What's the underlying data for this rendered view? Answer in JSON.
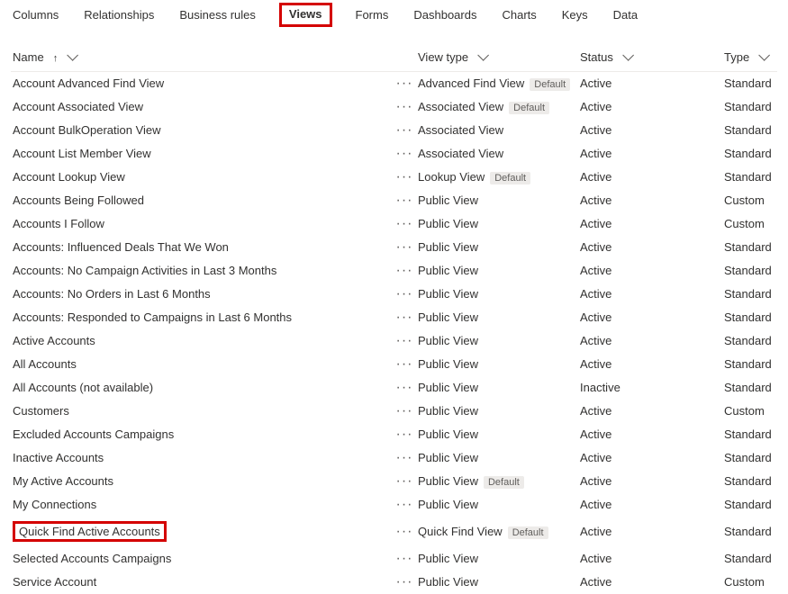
{
  "tabs": {
    "items": [
      {
        "label": "Columns",
        "key": "columns"
      },
      {
        "label": "Relationships",
        "key": "relationships"
      },
      {
        "label": "Business rules",
        "key": "business-rules"
      },
      {
        "label": "Views",
        "key": "views",
        "active": true,
        "highlight": true
      },
      {
        "label": "Forms",
        "key": "forms"
      },
      {
        "label": "Dashboards",
        "key": "dashboards"
      },
      {
        "label": "Charts",
        "key": "charts"
      },
      {
        "label": "Keys",
        "key": "keys"
      },
      {
        "label": "Data",
        "key": "data"
      }
    ]
  },
  "columns": {
    "name": "Name",
    "view_type": "View type",
    "status": "Status",
    "type": "Type"
  },
  "badge_default": "Default",
  "more_glyph": "···",
  "rows": [
    {
      "name": "Account Advanced Find View",
      "view_type": "Advanced Find View",
      "default": true,
      "status": "Active",
      "type": "Standard"
    },
    {
      "name": "Account Associated View",
      "view_type": "Associated View",
      "default": true,
      "status": "Active",
      "type": "Standard"
    },
    {
      "name": "Account BulkOperation View",
      "view_type": "Associated View",
      "default": false,
      "status": "Active",
      "type": "Standard"
    },
    {
      "name": "Account List Member View",
      "view_type": "Associated View",
      "default": false,
      "status": "Active",
      "type": "Standard"
    },
    {
      "name": "Account Lookup View",
      "view_type": "Lookup View",
      "default": true,
      "status": "Active",
      "type": "Standard"
    },
    {
      "name": "Accounts Being Followed",
      "view_type": "Public View",
      "default": false,
      "status": "Active",
      "type": "Custom"
    },
    {
      "name": "Accounts I Follow",
      "view_type": "Public View",
      "default": false,
      "status": "Active",
      "type": "Custom"
    },
    {
      "name": "Accounts: Influenced Deals That We Won",
      "view_type": "Public View",
      "default": false,
      "status": "Active",
      "type": "Standard"
    },
    {
      "name": "Accounts: No Campaign Activities in Last 3 Months",
      "view_type": "Public View",
      "default": false,
      "status": "Active",
      "type": "Standard"
    },
    {
      "name": "Accounts: No Orders in Last 6 Months",
      "view_type": "Public View",
      "default": false,
      "status": "Active",
      "type": "Standard"
    },
    {
      "name": "Accounts: Responded to Campaigns in Last 6 Months",
      "view_type": "Public View",
      "default": false,
      "status": "Active",
      "type": "Standard"
    },
    {
      "name": "Active Accounts",
      "view_type": "Public View",
      "default": false,
      "status": "Active",
      "type": "Standard"
    },
    {
      "name": "All Accounts",
      "view_type": "Public View",
      "default": false,
      "status": "Active",
      "type": "Standard"
    },
    {
      "name": "All Accounts (not available)",
      "view_type": "Public View",
      "default": false,
      "status": "Inactive",
      "type": "Standard"
    },
    {
      "name": "Customers",
      "view_type": "Public View",
      "default": false,
      "status": "Active",
      "type": "Custom"
    },
    {
      "name": "Excluded Accounts Campaigns",
      "view_type": "Public View",
      "default": false,
      "status": "Active",
      "type": "Standard"
    },
    {
      "name": "Inactive Accounts",
      "view_type": "Public View",
      "default": false,
      "status": "Active",
      "type": "Standard"
    },
    {
      "name": "My Active Accounts",
      "view_type": "Public View",
      "default": true,
      "status": "Active",
      "type": "Standard"
    },
    {
      "name": "My Connections",
      "view_type": "Public View",
      "default": false,
      "status": "Active",
      "type": "Standard"
    },
    {
      "name": "Quick Find Active Accounts",
      "view_type": "Quick Find View",
      "default": true,
      "status": "Active",
      "type": "Standard",
      "highlight": true
    },
    {
      "name": "Selected Accounts Campaigns",
      "view_type": "Public View",
      "default": false,
      "status": "Active",
      "type": "Standard"
    },
    {
      "name": "Service Account",
      "view_type": "Public View",
      "default": false,
      "status": "Active",
      "type": "Custom"
    }
  ]
}
